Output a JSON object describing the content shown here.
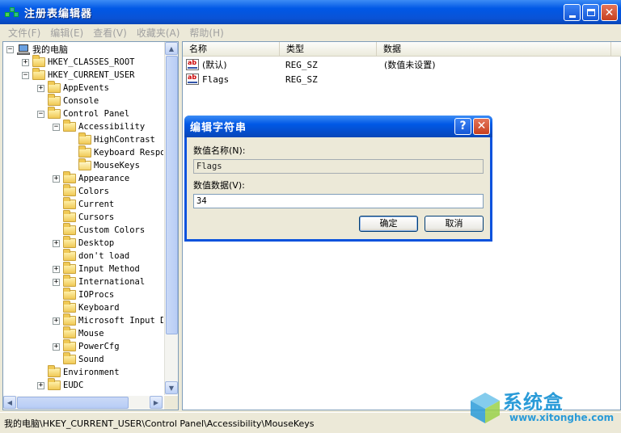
{
  "window": {
    "title": "注册表编辑器"
  },
  "menu": [
    "文件(F)",
    "编辑(E)",
    "查看(V)",
    "收藏夹(A)",
    "帮助(H)"
  ],
  "tree": {
    "items": [
      {
        "label": "我的电脑",
        "level": 0,
        "expander": "−",
        "icon": "computer-icon"
      },
      {
        "label": "HKEY_CLASSES_ROOT",
        "level": 1,
        "expander": "+",
        "icon": "folder-icon"
      },
      {
        "label": "HKEY_CURRENT_USER",
        "level": 1,
        "expander": "−",
        "icon": "folder-icon"
      },
      {
        "label": "AppEvents",
        "level": 2,
        "expander": "+",
        "icon": "folder-icon"
      },
      {
        "label": "Console",
        "level": 2,
        "expander": "",
        "icon": "folder-icon"
      },
      {
        "label": "Control Panel",
        "level": 2,
        "expander": "−",
        "icon": "folder-icon"
      },
      {
        "label": "Accessibility",
        "level": 3,
        "expander": "−",
        "icon": "folder-icon"
      },
      {
        "label": "HighContrast",
        "level": 4,
        "expander": "",
        "icon": "folder-icon"
      },
      {
        "label": "Keyboard Respo",
        "level": 4,
        "expander": "",
        "icon": "folder-icon"
      },
      {
        "label": "MouseKeys",
        "level": 4,
        "expander": "",
        "icon": "folder-open-icon"
      },
      {
        "label": "Appearance",
        "level": 3,
        "expander": "+",
        "icon": "folder-icon"
      },
      {
        "label": "Colors",
        "level": 3,
        "expander": "",
        "icon": "folder-icon"
      },
      {
        "label": "Current",
        "level": 3,
        "expander": "",
        "icon": "folder-icon"
      },
      {
        "label": "Cursors",
        "level": 3,
        "expander": "",
        "icon": "folder-icon"
      },
      {
        "label": "Custom Colors",
        "level": 3,
        "expander": "",
        "icon": "folder-icon"
      },
      {
        "label": "Desktop",
        "level": 3,
        "expander": "+",
        "icon": "folder-icon"
      },
      {
        "label": "don't load",
        "level": 3,
        "expander": "",
        "icon": "folder-icon"
      },
      {
        "label": "Input Method",
        "level": 3,
        "expander": "+",
        "icon": "folder-icon"
      },
      {
        "label": "International",
        "level": 3,
        "expander": "+",
        "icon": "folder-icon"
      },
      {
        "label": "IOProcs",
        "level": 3,
        "expander": "",
        "icon": "folder-icon"
      },
      {
        "label": "Keyboard",
        "level": 3,
        "expander": "",
        "icon": "folder-icon"
      },
      {
        "label": "Microsoft Input D",
        "level": 3,
        "expander": "+",
        "icon": "folder-icon"
      },
      {
        "label": "Mouse",
        "level": 3,
        "expander": "",
        "icon": "folder-icon"
      },
      {
        "label": "PowerCfg",
        "level": 3,
        "expander": "+",
        "icon": "folder-icon"
      },
      {
        "label": "Sound",
        "level": 3,
        "expander": "",
        "icon": "folder-icon"
      },
      {
        "label": "Environment",
        "level": 2,
        "expander": "",
        "icon": "folder-icon"
      },
      {
        "label": "EUDC",
        "level": 2,
        "expander": "+",
        "icon": "folder-icon"
      }
    ]
  },
  "list": {
    "headers": [
      "名称",
      "类型",
      "数据"
    ],
    "rows": [
      {
        "name": "(默认)",
        "type": "REG_SZ",
        "data": "(数值未设置)"
      },
      {
        "name": "Flags",
        "type": "REG_SZ",
        "data": ""
      }
    ]
  },
  "status": {
    "path": "我的电脑\\HKEY_CURRENT_USER\\Control Panel\\Accessibility\\MouseKeys"
  },
  "dialog": {
    "title": "编辑字符串",
    "name_label": "数值名称(N):",
    "name_value": "Flags",
    "data_label": "数值数据(V):",
    "data_value": "34",
    "ok_label": "确定",
    "cancel_label": "取消",
    "help_glyph": "?",
    "close_glyph": "✕"
  },
  "watermark": {
    "title": "系统盒",
    "url": "www.xitonghe.com"
  },
  "colors": {
    "titlebar": "#0058e6",
    "face": "#ece9d8",
    "border": "#7f9db9"
  }
}
